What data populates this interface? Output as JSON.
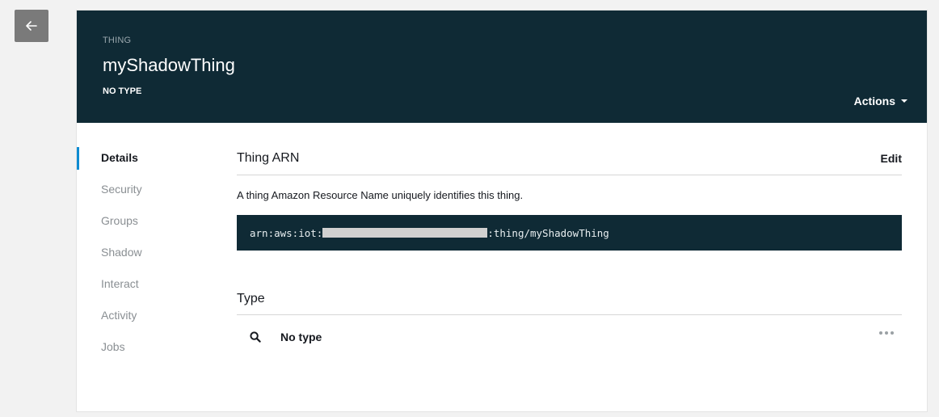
{
  "header": {
    "kind_label": "THING",
    "thing_name": "myShadowThing",
    "thing_type": "NO TYPE",
    "actions_label": "Actions"
  },
  "sidenav": {
    "items": [
      {
        "label": "Details"
      },
      {
        "label": "Security"
      },
      {
        "label": "Groups"
      },
      {
        "label": "Shadow"
      },
      {
        "label": "Interact"
      },
      {
        "label": "Activity"
      },
      {
        "label": "Jobs"
      }
    ],
    "active": "Details"
  },
  "arn_section": {
    "title": "Thing ARN",
    "edit_label": "Edit",
    "description": "A thing Amazon Resource Name uniquely identifies this thing.",
    "arn_prefix": "arn:aws:iot:",
    "arn_suffix": ":thing/myShadowThing"
  },
  "type_section": {
    "title": "Type",
    "value": "No type"
  },
  "colors": {
    "header_bg": "#0f2a35",
    "active_indicator": "#0d8bd1",
    "page_bg": "#f2f2f2"
  }
}
